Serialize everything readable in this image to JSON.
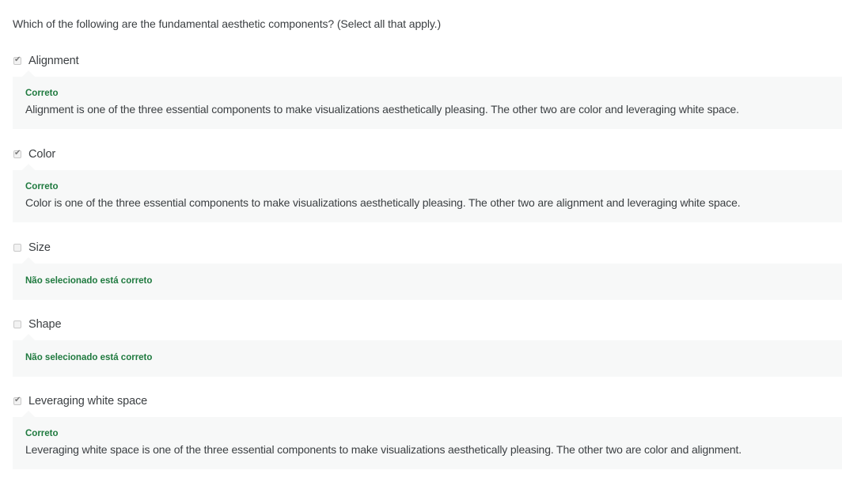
{
  "question": "Which of the following are the fundamental aesthetic components? (Select all that apply.)",
  "options": [
    {
      "label": "Alignment",
      "checked": true,
      "feedback_status": "Correto",
      "feedback_text": "Alignment is one of the three essential components to make visualizations aesthetically pleasing. The other two are color and leveraging white space."
    },
    {
      "label": "Color",
      "checked": true,
      "feedback_status": "Correto",
      "feedback_text": "Color is one of the three essential components to make visualizations aesthetically pleasing. The other two are alignment and leveraging white space."
    },
    {
      "label": "Size",
      "checked": false,
      "feedback_status": "Não selecionado está correto",
      "feedback_text": ""
    },
    {
      "label": "Shape",
      "checked": false,
      "feedback_status": "Não selecionado está correto",
      "feedback_text": ""
    },
    {
      "label": "Leveraging white space",
      "checked": true,
      "feedback_status": "Correto",
      "feedback_text": "Leveraging white space is one of the three essential components to make visualizations aesthetically pleasing. The other two are color and alignment."
    }
  ],
  "colors": {
    "correct_green": "#1f7a3f",
    "feedback_bg": "#f7f8f8",
    "text": "#3b3f42"
  },
  "icons": {
    "checked": "checkbox-checked-icon",
    "unchecked": "checkbox-unchecked-icon"
  }
}
